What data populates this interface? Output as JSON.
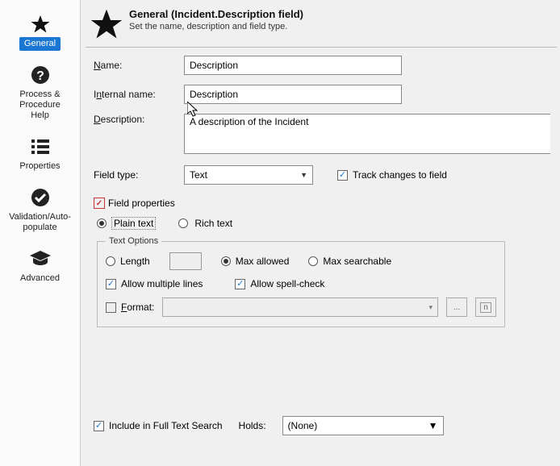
{
  "sidebar": {
    "items": [
      {
        "label": "General"
      },
      {
        "label": "Process & Procedure Help"
      },
      {
        "label": "Properties"
      },
      {
        "label": "Validation/Auto-populate"
      },
      {
        "label": "Advanced"
      }
    ]
  },
  "header": {
    "title": "General (Incident.Description field)",
    "subtitle": "Set the name, description and field type."
  },
  "form": {
    "name_label_pre": "N",
    "name_label_post": "ame:",
    "internal_label_pre": "I",
    "internal_label_mid": "n",
    "internal_label_post": "ternal name:",
    "desc_label_pre": "D",
    "desc_label_post": "escription:",
    "name_value": "Description",
    "internal_value": "Description",
    "description_value": "A description of the Incident",
    "field_type_label": "Field type:",
    "field_type_value": "Text",
    "track_changes_label": "Track changes to field",
    "field_properties_label": "Field properties",
    "plain_text_label": "Plain text",
    "rich_text_label": "Rich text",
    "text_options_legend": "Text Options",
    "length_label": "Length",
    "max_allowed_label": "Max allowed",
    "max_searchable_label": "Max searchable",
    "allow_multiple_label": "Allow multiple lines",
    "allow_spell_label": "Allow spell-check",
    "format_label_pre": "F",
    "format_label_mid": "o",
    "format_label_post": "rmat:",
    "ellipsis": "...",
    "n_btn": "n"
  },
  "bottom": {
    "include_label": "Include in Full Text Search",
    "holds_label": "Holds:",
    "holds_value": "(None)"
  }
}
